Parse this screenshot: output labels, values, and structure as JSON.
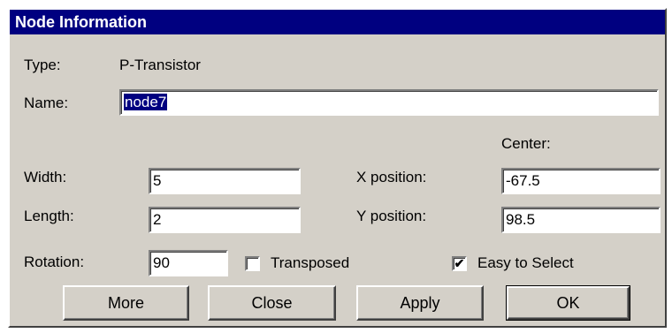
{
  "window": {
    "title": "Node Information"
  },
  "type": {
    "label": "Type:",
    "value": "P-Transistor"
  },
  "name": {
    "label": "Name:",
    "value": "node7"
  },
  "center": {
    "label": "Center:"
  },
  "width": {
    "label": "Width:",
    "value": "5"
  },
  "length": {
    "label": "Length:",
    "value": "2"
  },
  "x_position": {
    "label": "X position:",
    "value": "-67.5"
  },
  "y_position": {
    "label": "Y position:",
    "value": "98.5"
  },
  "rotation": {
    "label": "Rotation:",
    "value": "90"
  },
  "transposed": {
    "label": "Transposed",
    "checked": false
  },
  "easy_to_select": {
    "label": "Easy to Select",
    "checked": true,
    "mark": "✔"
  },
  "buttons": {
    "more": "More",
    "close": "Close",
    "apply": "Apply",
    "ok": "OK"
  },
  "colors": {
    "titlebar": "#000080",
    "face": "#d4d0c8",
    "selection": "#000080"
  }
}
